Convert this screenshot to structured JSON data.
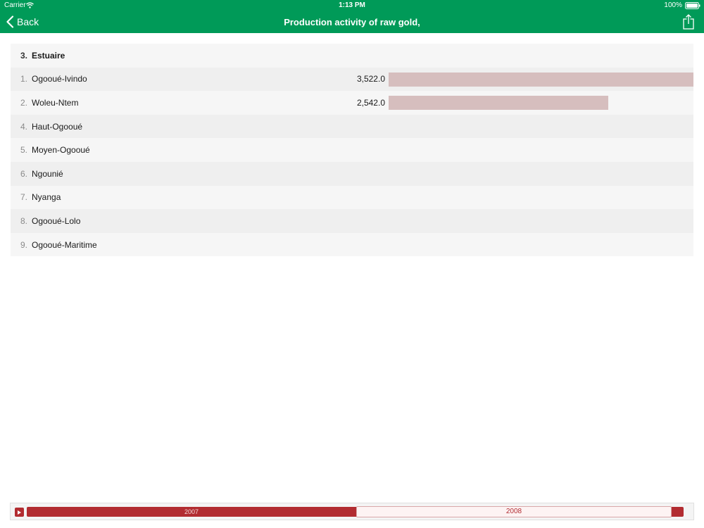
{
  "status_bar": {
    "carrier": "Carrier",
    "time": "1:13 PM",
    "battery": "100%"
  },
  "nav": {
    "back_label": "Back",
    "title": "Production activity of raw gold,"
  },
  "list": {
    "header": {
      "rank": "3.",
      "name": "Estuaire"
    },
    "rows": [
      {
        "rank": "1.",
        "name": "Ogooué-Ivindo",
        "value": "3,522.0",
        "fraction": 1.0
      },
      {
        "rank": "2.",
        "name": "Woleu-Ntem",
        "value": "2,542.0",
        "fraction": 0.7217
      },
      {
        "rank": "4.",
        "name": "Haut-Ogooué"
      },
      {
        "rank": "5.",
        "name": "Moyen-Ogooué"
      },
      {
        "rank": "6.",
        "name": "Ngounié"
      },
      {
        "rank": "7.",
        "name": "Nyanga"
      },
      {
        "rank": "8.",
        "name": "Ogooué-Lolo"
      },
      {
        "rank": "9.",
        "name": "Ogooué-Maritime"
      }
    ]
  },
  "timeline": {
    "years": [
      "2007",
      "2008"
    ],
    "selected": "2008"
  },
  "colors": {
    "brand": "#009a58",
    "bar": "#d6bebe",
    "timeline": "#b22c31"
  },
  "icons": {
    "back": "chevron-left-icon",
    "share": "share-icon",
    "play": "play-icon"
  }
}
